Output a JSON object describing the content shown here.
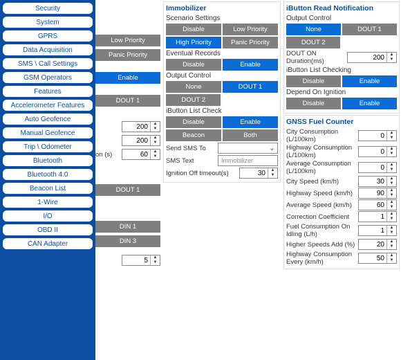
{
  "sidebar": {
    "items": [
      "Security",
      "System",
      "GPRS",
      "Data Acquisition",
      "SMS \\ Call Settings",
      "GSM Operators",
      "Features",
      "Accelerometer Features",
      "Auto Geofence",
      "Manual Geofence",
      "Trip \\ Odometer",
      "Bluetooth",
      "Bluetooth 4.0",
      "Beacon List",
      "1-Wire",
      "I/O",
      "OBD II",
      "CAN Adapter"
    ]
  },
  "col1": {
    "priority": {
      "low": "Low Priority",
      "panic": "Panic Priority"
    },
    "enable": "Enable",
    "dout1_a": "DOUT 1",
    "spin1": 200,
    "spin2": 200,
    "spin3_label": "on (s)",
    "spin3": 60,
    "dout1_b": "DOUT 1",
    "din1": "DIN 1",
    "din3": "DIN 3",
    "five": "5"
  },
  "immobilizer": {
    "title": "Immobilizer",
    "scenario_label": "Scenario Settings",
    "disable": "Disable",
    "low": "Low Priority",
    "high": "High Priority",
    "panic": "Panic Priority",
    "event_label": "Eventual Records",
    "ev_disable": "Disable",
    "ev_enable": "Enable",
    "output_label": "Output Control",
    "none": "None",
    "dout1": "DOUT 1",
    "dout2": "DOUT 2",
    "iblist_label": "iButton List Check",
    "ib_disable": "Disable",
    "ib_enable": "Enable",
    "beacon": "Beacon",
    "both": "Both",
    "send_sms_label": "Send SMS To",
    "sms_text_label": "SMS Text",
    "sms_text_placeholder": "Immobilizer",
    "ign_off_label": "Ignition Off timeout(s)",
    "ign_off": 30
  },
  "ibutton": {
    "title": "iButton Read Notification",
    "output_label": "Output Control",
    "none": "None",
    "dout1": "DOUT 1",
    "dout2": "DOUT 2",
    "dur_label": "DOUT ON Duration(ms)",
    "dur": 200,
    "listchk_label": "iButton List Checking",
    "disable": "Disable",
    "enable": "Enable",
    "depend_label": "Depend On Ignition",
    "d_disable": "Disable",
    "d_enable": "Enable"
  },
  "gnss": {
    "title": "GNSS Fuel Counter",
    "rows": [
      {
        "label": "City Consumption (L/100km)",
        "value": 0
      },
      {
        "label": "Highway Consumption (L/100km)",
        "value": 0
      },
      {
        "label": "Average Consumption (L/100km)",
        "value": 0
      },
      {
        "label": "City Speed (km/h)",
        "value": 30
      },
      {
        "label": "Highway Speed (km/h)",
        "value": 90
      },
      {
        "label": "Average Speed (km/h)",
        "value": 60
      },
      {
        "label": "Correction Coefficient",
        "value": 1
      },
      {
        "label": "Fuel Consumption On Idling (L/h)",
        "value": 1
      },
      {
        "label": "Higher Speeds Add (%)",
        "value": 20
      },
      {
        "label": "Highway Consumption Every (km/h)",
        "value": 50
      }
    ]
  }
}
